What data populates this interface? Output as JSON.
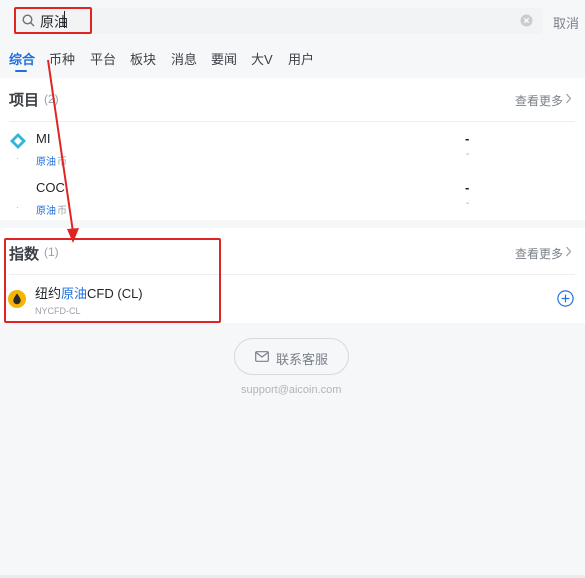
{
  "search": {
    "query": "原油",
    "cancel_label": "取消"
  },
  "tabs": [
    {
      "label": "综合"
    },
    {
      "label": "币种"
    },
    {
      "label": "平台"
    },
    {
      "label": "板块"
    },
    {
      "label": "消息"
    },
    {
      "label": "要闻"
    },
    {
      "label": "大V"
    },
    {
      "label": "用户"
    }
  ],
  "projects": {
    "title": "项目",
    "count": "(2)",
    "see_more": "查看更多",
    "items": [
      {
        "name": "MI",
        "tag_hl": "原油",
        "tag_rest": "币",
        "dot": "·",
        "price": "-",
        "change": "-"
      },
      {
        "name": "COC",
        "tag_hl": "原油",
        "tag_rest": "币",
        "dot": "·",
        "price": "-",
        "change": "-"
      }
    ]
  },
  "indices": {
    "title": "指数",
    "count": "(1)",
    "see_more": "查看更多",
    "items": [
      {
        "name_pre": "纽约",
        "name_hl": "原油",
        "name_post": "CFD (CL)",
        "code": "NYCFD-CL"
      }
    ]
  },
  "contact": {
    "label": "联系客服",
    "email": "support@aicoin.com"
  },
  "colors": {
    "accent": "#1f6fe0",
    "annotation": "#e02424"
  },
  "icons": [
    "search-icon",
    "clear-icon",
    "chevron-right-icon",
    "mi-logo-icon",
    "oil-drop-icon",
    "add-circle-icon",
    "mail-icon"
  ]
}
